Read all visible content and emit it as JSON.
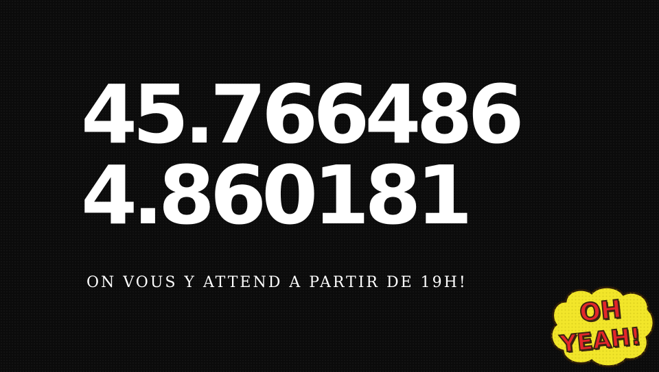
{
  "coordinates": {
    "latitude": "45.766486",
    "longitude": "4.860181"
  },
  "tagline": "ON VOUS Y ATTEND A PARTIR DE 19H!",
  "sticker": {
    "line1": "OH",
    "line2": "YEAH!",
    "colors": {
      "cloud": "#f2e62a",
      "text": "#e3262b",
      "outline": "#3a2410"
    }
  },
  "colors": {
    "background": "#0b0b0b",
    "text": "#ffffff"
  }
}
